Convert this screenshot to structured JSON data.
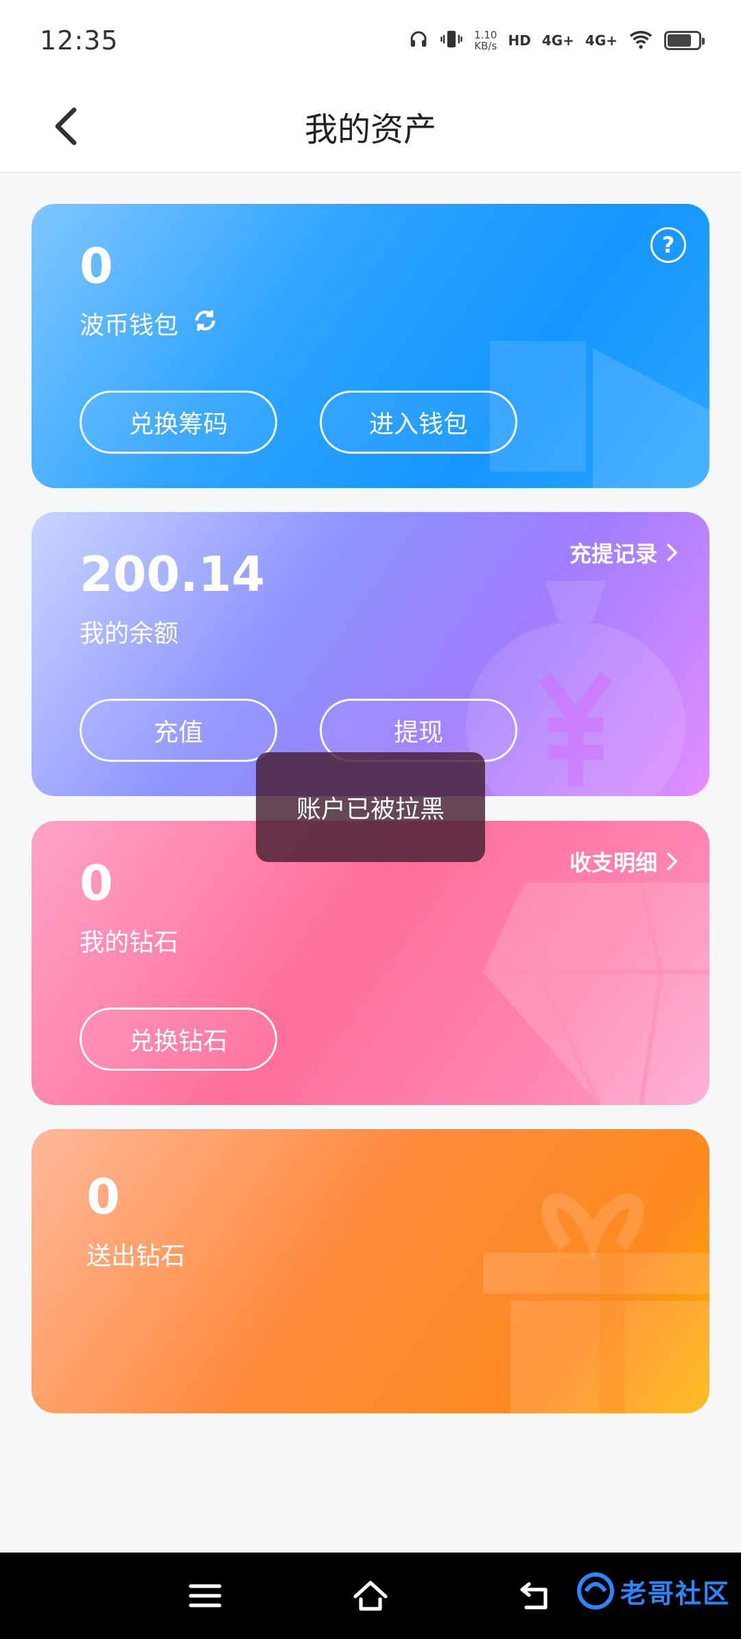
{
  "status_bar": {
    "time": "12:35",
    "net_speed_top": "1.10",
    "net_speed_bottom": "KB/s",
    "hd_tag": "HD",
    "sim1": "4G+",
    "sim2": "4G+"
  },
  "header": {
    "title": "我的资产"
  },
  "wallet_card": {
    "value": "0",
    "label": "波币钱包",
    "buttons": [
      "兑换筹码",
      "进入钱包"
    ],
    "help": "?"
  },
  "balance_card": {
    "value": "200.14",
    "label": "我的余额",
    "link": "充提记录",
    "buttons": [
      "充值",
      "提现"
    ]
  },
  "diamond_card": {
    "value": "0",
    "label": "我的钻石",
    "link": "收支明细",
    "buttons": [
      "兑换钻石"
    ]
  },
  "sent_card": {
    "value": "0",
    "label": "送出钻石"
  },
  "toast": {
    "message": "账户已被拉黑"
  },
  "navbar": {
    "watermark_text": "老哥社区"
  },
  "colors": {
    "wallet": "#1596ff",
    "balance": "#a07dff",
    "diamond": "#ff6f9a",
    "sent": "#ff8a1f"
  }
}
